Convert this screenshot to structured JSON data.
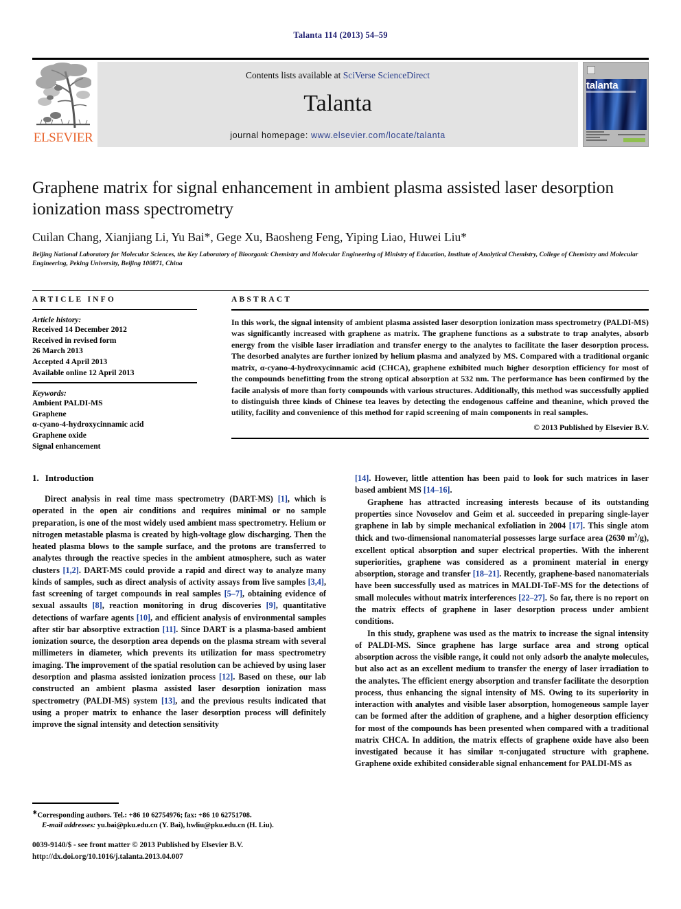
{
  "running_head": "Talanta 114 (2013) 54–59",
  "masthead": {
    "contents_prefix": "Contents lists available at ",
    "contents_link": "SciVerse ScienceDirect",
    "journal_title": "Talanta",
    "homepage_prefix": "journal homepage: ",
    "homepage_url": "www.elsevier.com/locate/talanta",
    "publisher_logo_text": "ELSEVIER",
    "cover_wordmark": "talanta",
    "colors": {
      "link_blue": "#2b3f8c",
      "elsevier_orange": "#E8622A",
      "band_grey": "#e3e3e3"
    }
  },
  "article": {
    "title": "Graphene matrix for signal enhancement in ambient plasma assisted laser desorption ionization mass spectrometry",
    "authors": "Cuilan Chang, Xianjiang Li, Yu Bai*, Gege Xu, Baosheng Feng, Yiping Liao, Huwei Liu*",
    "affiliation": "Beijing National Laboratory for Molecular Sciences, the Key Laboratory of Bioorganic Chemistry and Molecular Engineering of Ministry of Education, Institute of Analytical Chemistry, College of Chemistry and Molecular Engineering, Peking University, Beijing 100871, China"
  },
  "article_info": {
    "heading": "ARTICLE INFO",
    "history_label": "Article history:",
    "history": [
      "Received 14 December 2012",
      "Received in revised form",
      "26 March 2013",
      "Accepted 4 April 2013",
      "Available online 12 April 2013"
    ],
    "keywords_label": "Keywords:",
    "keywords": [
      "Ambient PALDI-MS",
      "Graphene",
      "α-cyano-4-hydroxycinnamic acid",
      "Graphene oxide",
      "Signal enhancement"
    ]
  },
  "abstract": {
    "heading": "ABSTRACT",
    "text": "In this work, the signal intensity of ambient plasma assisted laser desorption ionization mass spectrometry (PALDI-MS) was significantly increased with graphene as matrix. The graphene functions as a substrate to trap analytes, absorb energy from the visible laser irradiation and transfer energy to the analytes to facilitate the laser desorption process. The desorbed analytes are further ionized by helium plasma and analyzed by MS. Compared with a traditional organic matrix, α-cyano-4-hydroxycinnamic acid (CHCA), graphene exhibited much higher desorption efficiency for most of the compounds benefitting from the strong optical absorption at 532 nm. The performance has been confirmed by the facile analysis of more than forty compounds with various structures. Additionally, this method was successfully applied to distinguish three kinds of Chinese tea leaves by detecting the endogenous caffeine and theanine, which proved the utility, facility and convenience of this method for rapid screening of main components in real samples.",
    "copyright": "© 2013 Published by Elsevier B.V."
  },
  "introduction": {
    "heading_number": "1.",
    "heading_text": "Introduction",
    "left_paragraph_1_part1": "Direct analysis in real time mass spectrometry (DART-MS) ",
    "left_ref_1": "[1]",
    "left_paragraph_1_part2": ", which is operated in the open air conditions and requires minimal or no sample preparation, is one of the most widely used ambient mass spectrometry. Helium or nitrogen metastable plasma is created by high-voltage glow discharging. Then the heated plasma blows to the sample surface, and the protons are transferred to analytes through the reactive species in the ambient atmosphere, such as water clusters ",
    "left_ref_2": "[1,2]",
    "left_paragraph_1_part3": ". DART-MS could provide a rapid and direct way to analyze many kinds of samples, such as direct analysis of activity assays from live samples ",
    "left_ref_3": "[3,4]",
    "left_paragraph_1_part4": ", fast screening of target compounds in real samples ",
    "left_ref_4": "[5–7]",
    "left_paragraph_1_part5": ", obtaining evidence of sexual assaults ",
    "left_ref_5": "[8]",
    "left_paragraph_1_part6": ", reaction monitoring in drug discoveries ",
    "left_ref_6": "[9]",
    "left_paragraph_1_part7": ", quantitative detections of warfare agents ",
    "left_ref_7": "[10]",
    "left_paragraph_1_part8": ", and efficient analysis of environmental samples after stir bar absorptive extraction ",
    "left_ref_8": "[11]",
    "left_paragraph_1_part9": ". Since DART is a plasma-based ambient ionization source, the desorption area depends on the plasma stream with several millimeters in diameter, which prevents its utilization for mass spectrometry imaging. The improvement of the spatial resolution can be achieved by using laser desorption and plasma assisted ionization process ",
    "left_ref_9": "[12]",
    "left_paragraph_1_part10": ". Based on these, our lab constructed an ambient plasma assisted laser desorption ionization mass spectrometry (PALDI-MS) system ",
    "left_ref_10": "[13]",
    "left_paragraph_1_part11": ", and the previous results indicated that using a proper matrix to enhance the laser desorption process will definitely improve the signal intensity and detection sensitivity",
    "right_ref_14a": "[14]",
    "right_paragraph_0_part1": ". However, little attention has been paid to look for such matrices in laser based ambient MS ",
    "right_ref_14_16": "[14–16]",
    "right_paragraph_0_part2": ".",
    "right_paragraph_1_part1": "Graphene has attracted increasing interests because of its outstanding properties since Novoselov and Geim et al. succeeded in preparing single-layer graphene in lab by simple mechanical exfoliation in 2004 ",
    "right_ref_17": "[17]",
    "right_paragraph_1_part2": ". This single atom thick and two-dimensional nanomaterial possesses large surface area (2630 m",
    "right_paragraph_1_sup": "2",
    "right_paragraph_1_part3": "/g), excellent optical absorption and super electrical properties. With the inherent superiorities, graphene was considered as a prominent material in energy absorption, storage and transfer ",
    "right_ref_18_21": "[18–21]",
    "right_paragraph_1_part4": ". Recently, graphene-based nanomaterials have been successfully used as matrices in MALDI-ToF-MS for the detections of small molecules without matrix interferences ",
    "right_ref_22_27": "[22–27]",
    "right_paragraph_1_part5": ". So far, there is no report on the matrix effects of graphene in laser desorption process under ambient conditions.",
    "right_paragraph_2": "In this study, graphene was used as the matrix to increase the signal intensity of PALDI-MS. Since graphene has large surface area and strong optical absorption across the visible range, it could not only adsorb the analyte molecules, but also act as an excellent medium to transfer the energy of laser irradiation to the analytes. The efficient energy absorption and transfer facilitate the desorption process, thus enhancing the signal intensity of MS. Owing to its superiority in interaction with analytes and visible laser absorption, homogeneous sample layer can be formed after the addition of graphene, and a higher desorption efficiency for most of the compounds has been presented when compared with a traditional matrix CHCA. In addition, the matrix effects of graphene oxide have also been investigated because it has similar π-conjugated structure with graphene. Graphene oxide exhibited considerable signal enhancement for PALDI-MS as"
  },
  "footnote": {
    "corresponding": "Corresponding authors. Tel.: +86 10 62754976; fax: +86 10 62751708.",
    "email_label": "E-mail addresses:",
    "emails": "yu.bai@pku.edu.cn (Y. Bai), hwliu@pku.edu.cn (H. Liu)."
  },
  "colophon": {
    "issn_line": "0039-9140/$ - see front matter © 2013 Published by Elsevier B.V.",
    "doi_line": "http://dx.doi.org/10.1016/j.talanta.2013.04.007"
  }
}
